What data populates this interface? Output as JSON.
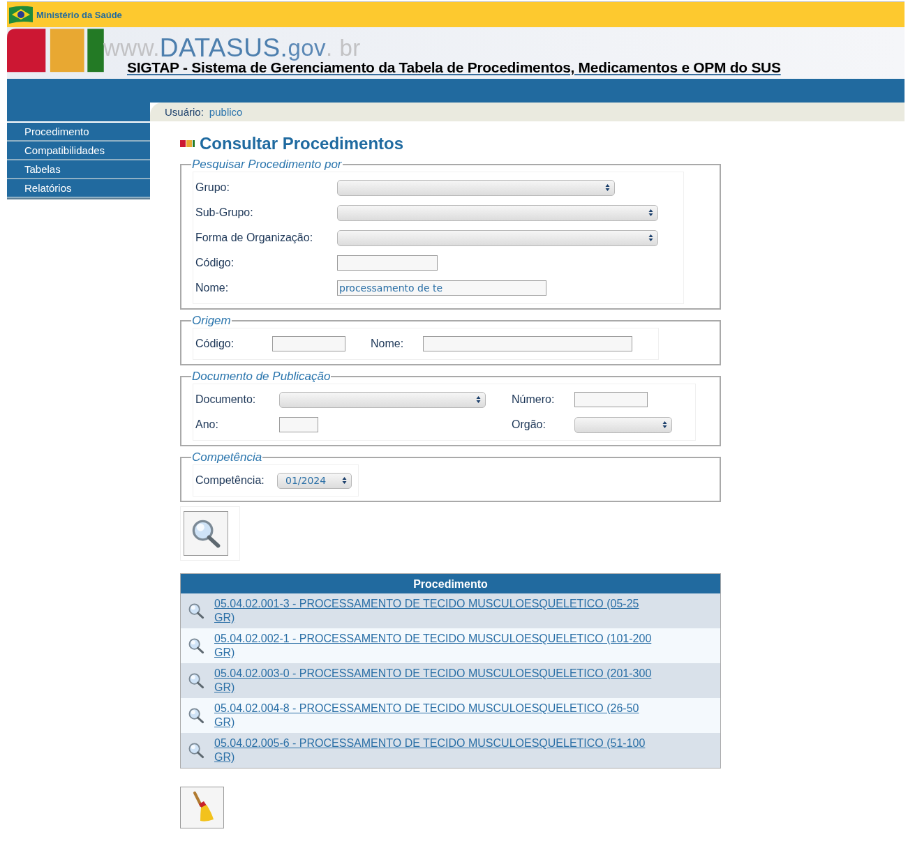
{
  "top_bar": {
    "ministry": "Ministério da Saúde"
  },
  "banner": {
    "logo_parts": [
      {
        "kind": "muted",
        "text": "www."
      },
      {
        "kind": "strong",
        "text": "DATASUS."
      },
      {
        "kind": "soft",
        "text": "gov"
      },
      {
        "kind": "muted",
        "text": ". br"
      }
    ],
    "title": "SIGTAP - Sistema de Gerenciamento da Tabela de Procedimentos, Medicamentos e OPM do SUS"
  },
  "user_bar": {
    "label": "Usuário:",
    "user": "publico"
  },
  "sidebar": {
    "items": [
      {
        "label": "Procedimento"
      },
      {
        "label": "Compatibilidades"
      },
      {
        "label": "Tabelas"
      },
      {
        "label": "Relatórios"
      }
    ]
  },
  "page_title": "Consultar Procedimentos",
  "sections": [
    {
      "legend": "Pesquisar Procedimento por",
      "fields": [
        {
          "label": "Grupo:",
          "kind": "select"
        },
        {
          "label": "Sub-Grupo:",
          "kind": "select"
        },
        {
          "label": "Forma de Organização:",
          "kind": "select"
        },
        {
          "label": "Código:",
          "kind": "text"
        },
        {
          "label": "Nome:",
          "kind": "text",
          "value": "processamento de te"
        }
      ]
    },
    {
      "legend": "Origem",
      "fields": [
        {
          "label": "Código:",
          "kind": "text"
        },
        {
          "label": "Nome:",
          "kind": "text"
        }
      ]
    },
    {
      "legend": "Documento de Publicação",
      "fields": [
        {
          "label": "Documento:",
          "kind": "select"
        },
        {
          "label": "Número:",
          "kind": "text"
        },
        {
          "label": "Ano:",
          "kind": "text"
        },
        {
          "label": "Orgão:",
          "kind": "select"
        }
      ]
    },
    {
      "legend": "Competência",
      "fields": [
        {
          "label": "Competência:",
          "kind": "select",
          "value": "01/2024"
        }
      ]
    }
  ],
  "results": {
    "column": "Procedimento",
    "rows": [
      {
        "text": "05.04.02.001-3 - PROCESSAMENTO DE TECIDO MUSCULOESQUELETICO (05-25 GR)"
      },
      {
        "text": "05.04.02.002-1 - PROCESSAMENTO DE TECIDO MUSCULOESQUELETICO (101-200 GR)"
      },
      {
        "text": "05.04.02.003-0 - PROCESSAMENTO DE TECIDO MUSCULOESQUELETICO (201-300 GR)"
      },
      {
        "text": "05.04.02.004-8 - PROCESSAMENTO DE TECIDO MUSCULOESQUELETICO (26-50 GR)"
      },
      {
        "text": "05.04.02.005-6 - PROCESSAMENTO DE TECIDO MUSCULOESQUELETICO (51-100 GR)"
      }
    ]
  }
}
